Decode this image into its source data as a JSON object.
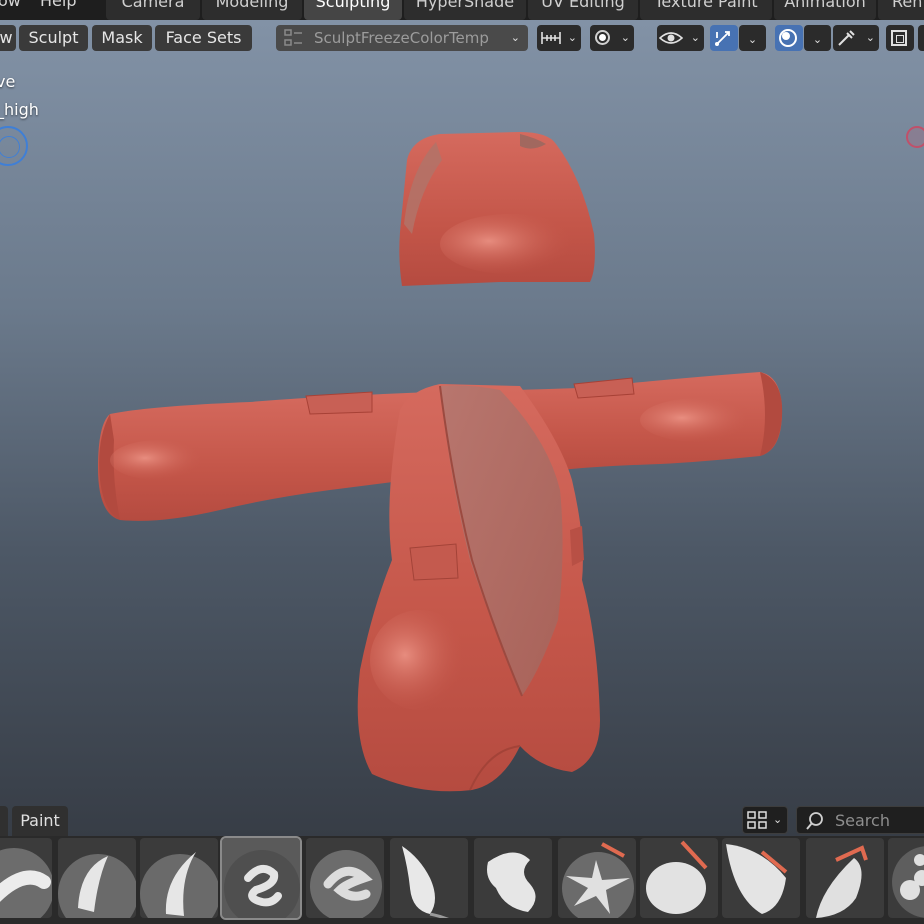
{
  "menubar": {
    "items": [
      "ow",
      "Help"
    ]
  },
  "workspace_tabs": [
    {
      "label": "Camera",
      "active": false
    },
    {
      "label": "Modeling",
      "active": false
    },
    {
      "label": "Sculpting",
      "active": true
    },
    {
      "label": "HyperShade",
      "active": false
    },
    {
      "label": "UV Editing",
      "active": false
    },
    {
      "label": "Texture Paint",
      "active": false
    },
    {
      "label": "Animation",
      "active": false
    },
    {
      "label": "Ren",
      "active": false
    }
  ],
  "header": {
    "view_partial": "w",
    "sculpt": "Sculpt",
    "mask": "Mask",
    "face_sets": "Face Sets",
    "active_object": "SculptFreezeColorTemp"
  },
  "overlay": {
    "line1": "ve",
    "line2": "_high"
  },
  "asset_shelf": {
    "tab": "Paint",
    "search_placeholder": "Search",
    "brush_icons": [
      "draw-brush-icon",
      "smooth-brush-icon",
      "draw-sharp-brush-icon",
      "clay-strips-brush-icon",
      "layer-brush-icon",
      "inflate-brush-icon",
      "blob-brush-icon",
      "crease-brush-icon",
      "flatten-brush-icon",
      "fill-brush-icon",
      "scrape-brush-icon",
      "multires-brush-icon"
    ]
  },
  "colors": {
    "accent_blue": "#4772b3",
    "mesh_red": "#c8594d",
    "viewport_top": "#8292a6",
    "viewport_bottom": "#373d46"
  }
}
